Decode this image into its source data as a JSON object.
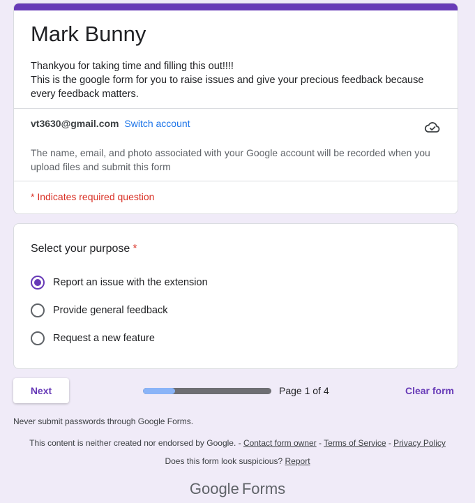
{
  "header": {
    "title": "Mark Bunny",
    "description_line1": "Thankyou for taking time and filling this out!!!!",
    "description_line2": "This is the google form for you to raise issues and give your precious feedback because every feedback matters.",
    "account_email": "vt3630@gmail.com",
    "switch_account": "Switch account",
    "notice": "The name, email, and photo associated with your Google account will be recorded when you upload files and submit this form",
    "required_note": "* Indicates required question",
    "accent_color": "#673ab7"
  },
  "question": {
    "title": "Select your purpose",
    "required_mark": "*",
    "options": [
      {
        "label": "Report an issue with the extension",
        "selected": true
      },
      {
        "label": "Provide general feedback",
        "selected": false
      },
      {
        "label": "Request a new feature",
        "selected": false
      }
    ]
  },
  "nav": {
    "next_label": "Next",
    "page_label": "Page 1 of 4",
    "progress_fraction": 0.25,
    "clear_label": "Clear form"
  },
  "footer": {
    "never_submit": "Never submit passwords through Google Forms.",
    "endorse_text": "This content is neither created nor endorsed by Google. - ",
    "contact_owner": "Contact form owner",
    "sep1": " - ",
    "terms": "Terms of Service",
    "sep2": " - ",
    "privacy": "Privacy Policy",
    "suspicious_text": "Does this form look suspicious? ",
    "report": "Report",
    "logo_google": "Google",
    "logo_forms": "Forms"
  }
}
